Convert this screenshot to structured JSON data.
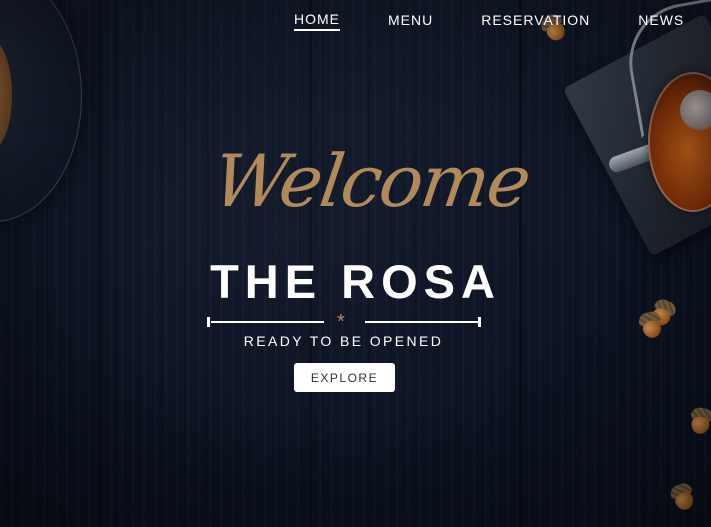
{
  "nav": {
    "items": [
      {
        "label": "HOME",
        "active": true
      },
      {
        "label": "MENU",
        "active": false
      },
      {
        "label": "RESERVATION",
        "active": false
      },
      {
        "label": "NEWS",
        "active": false
      }
    ]
  },
  "hero": {
    "welcome": "Welcome",
    "title": "THE ROSA",
    "subtitle": "READY TO BE OPENED",
    "cta_label": "EXPLORE",
    "divider_glyph": "*"
  },
  "colors": {
    "accent_gold": "#b28a5a",
    "background": "#0f1626",
    "text": "#ffffff"
  },
  "icons": {
    "divider": "asterisk-icon"
  }
}
